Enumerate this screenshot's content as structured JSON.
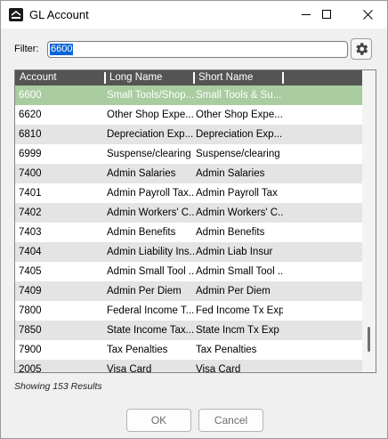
{
  "window": {
    "title": "GL Account",
    "app_icon": "grw-app-icon",
    "controls": [
      "minimize-icon",
      "maximize-icon",
      "close-icon"
    ]
  },
  "filter": {
    "label": "Filter:",
    "value": "6600",
    "settings_icon": "gear-icon"
  },
  "grid": {
    "columns": [
      "Account",
      "Long Name",
      "Short Name"
    ],
    "rows": [
      {
        "account": "6600",
        "long_name": "Small Tools/Shop...",
        "short_name": "Small Tools & Su...",
        "selected": true
      },
      {
        "account": "6620",
        "long_name": "Other Shop Expe...",
        "short_name": "Other Shop Expe..."
      },
      {
        "account": "6810",
        "long_name": "Depreciation Exp...",
        "short_name": "Depreciation Exp..."
      },
      {
        "account": "6999",
        "long_name": "Suspense/clearing",
        "short_name": "Suspense/clearing"
      },
      {
        "account": "7400",
        "long_name": "Admin Salaries",
        "short_name": "Admin Salaries"
      },
      {
        "account": "7401",
        "long_name": "Admin Payroll Tax...",
        "short_name": "Admin Payroll Tax"
      },
      {
        "account": "7402",
        "long_name": "Admin Workers' C...",
        "short_name": "Admin Workers' C..."
      },
      {
        "account": "7403",
        "long_name": "Admin Benefits",
        "short_name": "Admin Benefits"
      },
      {
        "account": "7404",
        "long_name": "Admin Liability Ins...",
        "short_name": "Admin Liab Insur"
      },
      {
        "account": "7405",
        "long_name": "Admin Small Tool ...",
        "short_name": "Admin Small Tool ..."
      },
      {
        "account": "7409",
        "long_name": "Admin Per Diem",
        "short_name": "Admin Per Diem"
      },
      {
        "account": "7800",
        "long_name": "Federal Income T...",
        "short_name": "Fed Income Tx Exp"
      },
      {
        "account": "7850",
        "long_name": "State Income Tax...",
        "short_name": "State Incm Tx Exp"
      },
      {
        "account": "7900",
        "long_name": "Tax Penalties",
        "short_name": "Tax Penalties"
      },
      {
        "account": "2005",
        "long_name": "Visa Card",
        "short_name": "Visa Card"
      }
    ]
  },
  "status": {
    "results_text": "Showing 153 Results"
  },
  "buttons": {
    "ok": "OK",
    "cancel": "Cancel"
  },
  "colors": {
    "header_bg": "#545454",
    "selected_row": "#a9cca0",
    "alt_row": "#e4e4e4",
    "text_highlight": "#0a64d8"
  }
}
